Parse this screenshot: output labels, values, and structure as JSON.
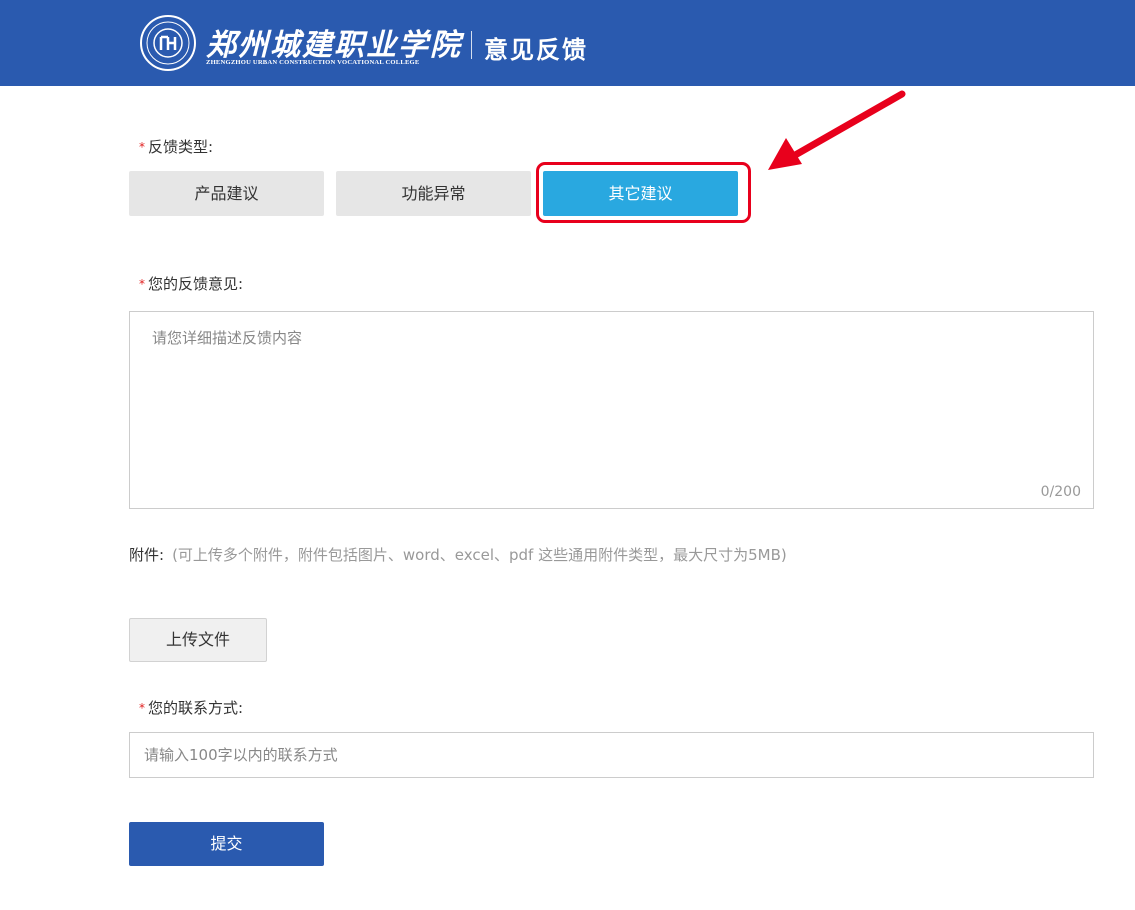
{
  "header": {
    "school_name": "郑州城建职业学院",
    "school_name_en": "ZHENGZHOU URBAN CONSTRUCTION VOCATIONAL COLLEGE",
    "page_title": "意见反馈",
    "background_color": "#2a5aaf"
  },
  "feedback_type": {
    "label": "反馈类型:",
    "required_mark": "*",
    "options": [
      {
        "label": "产品建议",
        "selected": false
      },
      {
        "label": "功能异常",
        "selected": false
      },
      {
        "label": "其它建议",
        "selected": true
      }
    ],
    "active_color": "#29a8e0",
    "annotation_color": "#e8001c"
  },
  "feedback_content": {
    "label": "您的反馈意见:",
    "required_mark": "*",
    "placeholder": "请您详细描述反馈内容",
    "value": "",
    "counter": "0/200"
  },
  "attachment": {
    "label": "附件:",
    "hint": "(可上传多个附件，附件包括图片、word、excel、pdf 这些通用附件类型，最大尺寸为5MB)",
    "upload_button": "上传文件"
  },
  "contact": {
    "label": "您的联系方式:",
    "required_mark": "*",
    "placeholder": "请输入100字以内的联系方式",
    "value": ""
  },
  "submit": {
    "label": "提交"
  }
}
